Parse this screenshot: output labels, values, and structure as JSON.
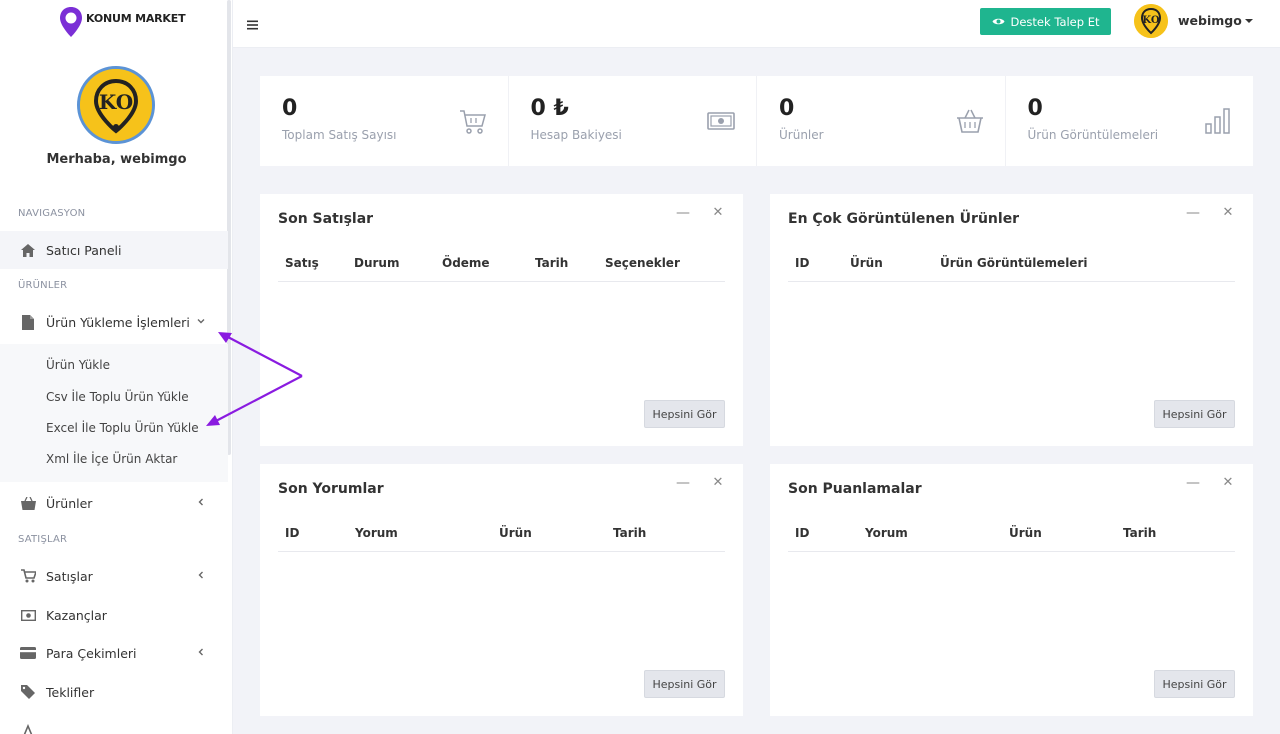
{
  "brand": {
    "name": "KONUM MARKET"
  },
  "sidebar": {
    "greeting": "Merhaba, webimgo",
    "sections": {
      "navigation": "NAVIGASYON",
      "products": "ÜRÜNLER",
      "sales": "SATIŞLAR"
    },
    "items": {
      "dashboard": "Satıcı Paneli",
      "upload_ops": "Ürün Yükleme İşlemleri",
      "products": "Ürünler",
      "sales": "Satışlar",
      "earnings": "Kazançlar",
      "withdrawals": "Para Çekimleri",
      "offers": "Teklifler"
    },
    "submenu": [
      "Ürün Yükle",
      "Csv İle Toplu Ürün Yükle",
      "Excel İle Toplu Ürün Yükle",
      "Xml İle İçe Ürün Aktar"
    ]
  },
  "topbar": {
    "support_label": "Destek Talep Et",
    "user_name": "webimgo",
    "support_color": "#1fb58f"
  },
  "stats": [
    {
      "value": "0",
      "label": "Toplam Satış Sayısı",
      "icon": "cart-icon"
    },
    {
      "value": "0 ₺",
      "label": "Hesap Bakiyesi",
      "icon": "money-icon"
    },
    {
      "value": "0",
      "label": "Ürünler",
      "icon": "basket-icon"
    },
    {
      "value": "0",
      "label": "Ürün Görüntülemeleri",
      "icon": "bar-chart-icon"
    }
  ],
  "panels": {
    "recent_sales": {
      "title": "Son Satışlar",
      "columns": [
        "Satış",
        "Durum",
        "Ödeme",
        "Tarih",
        "Seçenekler"
      ],
      "button": "Hepsini Gör"
    },
    "most_viewed": {
      "title": "En Çok Görüntülenen Ürünler",
      "columns": [
        "ID",
        "Ürün",
        "Ürün Görüntülemeleri"
      ],
      "button": "Hepsini Gör"
    },
    "recent_reviews": {
      "title": "Son Yorumlar",
      "columns": [
        "ID",
        "Yorum",
        "Ürün",
        "Tarih"
      ],
      "button": "Hepsini Gör"
    },
    "recent_ratings": {
      "title": "Son Puanlamalar",
      "columns": [
        "ID",
        "Yorum",
        "Ürün",
        "Tarih"
      ],
      "button": "Hepsini Gör"
    }
  },
  "annotation_color": "#8a1be0"
}
